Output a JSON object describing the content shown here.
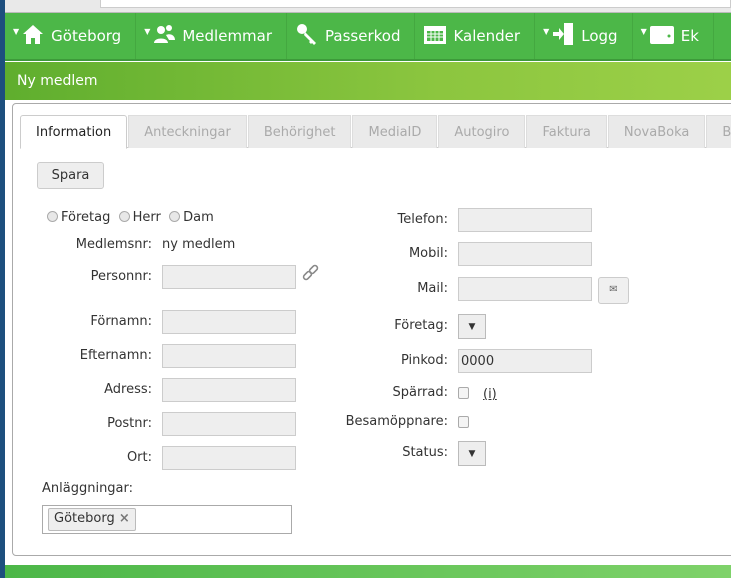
{
  "nav": [
    {
      "label": "Göteborg",
      "icon": "home-icon",
      "caret": true
    },
    {
      "label": "Medlemmar",
      "icon": "users-icon",
      "caret": true
    },
    {
      "label": "Passerkod",
      "icon": "key-icon",
      "caret": false
    },
    {
      "label": "Kalender",
      "icon": "calendar-icon",
      "caret": false
    },
    {
      "label": "Logg",
      "icon": "login-icon",
      "caret": true
    },
    {
      "label": "Ek",
      "icon": "wallet-icon",
      "caret": true
    }
  ],
  "subheader": {
    "title": "Ny medlem"
  },
  "tabs": [
    "Information",
    "Anteckningar",
    "Behörighet",
    "MediaID",
    "Autogiro",
    "Faktura",
    "NovaBoka",
    "Bi"
  ],
  "save_label": "Spara",
  "radios": [
    "Företag",
    "Herr",
    "Dam"
  ],
  "left": {
    "medlemsnr_label": "Medlemsnr:",
    "medlemsnr_value": "ny medlem",
    "personnr": "Personnr:",
    "fornamn": "Förnamn:",
    "efternamn": "Efternamn:",
    "adress": "Adress:",
    "postnr": "Postnr:",
    "ort": "Ort:",
    "anlaggningar": "Anläggningar:",
    "tag": "Göteborg",
    "tag_remove": "×"
  },
  "right": {
    "telefon": "Telefon:",
    "mobil": "Mobil:",
    "mail": "Mail:",
    "foretag": "Företag:",
    "pinkod": "Pinkod:",
    "pinkod_value": "0000",
    "sparrad": "Spärrad:",
    "info_link": "(i)",
    "besam": "Besamöppnare:",
    "status": "Status:"
  },
  "colors": {
    "nav": "#4cb748",
    "subheader": "#8cc63f"
  }
}
